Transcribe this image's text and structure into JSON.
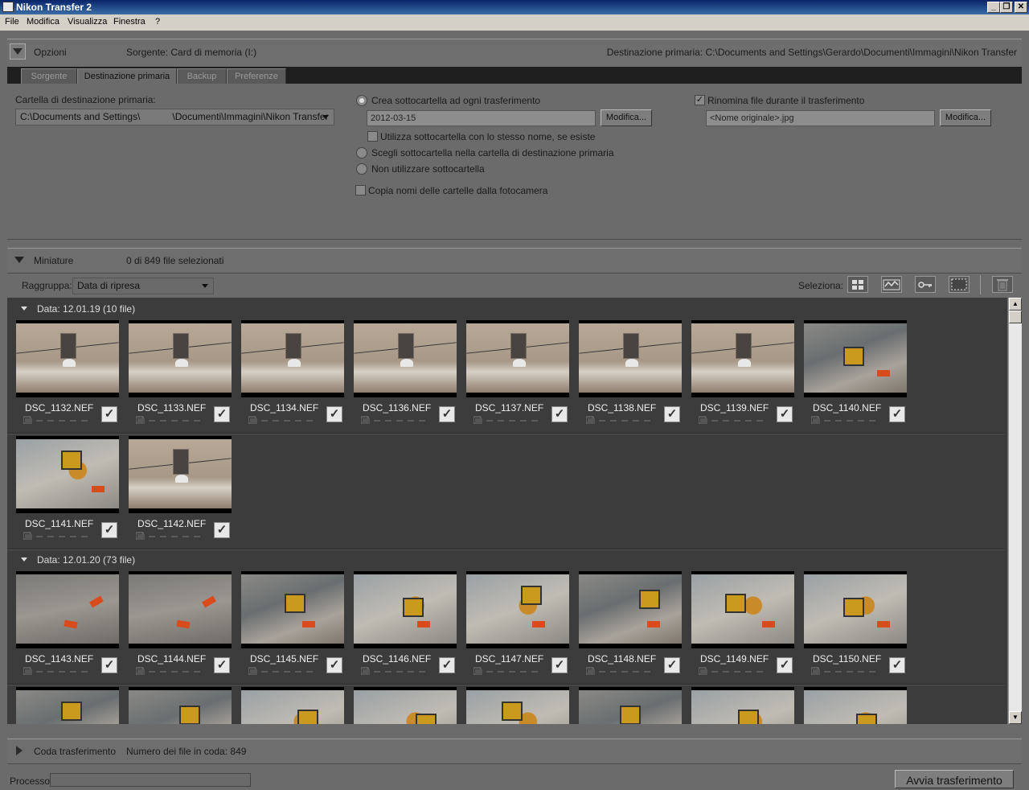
{
  "window": {
    "title": "Nikon Transfer 2"
  },
  "menu": [
    "File",
    "Modifica",
    "Visualizza",
    "Finestra",
    "?"
  ],
  "options_panel": {
    "label": "Opzioni",
    "source": "Sorgente: Card di memoria (I:)",
    "primary_destination": "Destinazione primaria: C:\\Documents and Settings\\Gerardo\\Documenti\\Immagini\\Nikon Transfer",
    "tabs": [
      "Sorgente",
      "Destinazione primaria",
      "Backup",
      "Preferenze"
    ],
    "active_tab": "Destinazione primaria",
    "dest_folder_label": "Cartella di destinazione primaria:",
    "dest_folder_value": "C:\\Documents and Settings\\            \\Documenti\\Immagini\\Nikon Transfer",
    "create_subfolder_label": "Crea sottocartella ad ogni trasferimento",
    "subfolder_name": "2012-03-15",
    "modify_label": "Modifica...",
    "use_existing_label": "Utilizza sottocartella con lo stesso nome, se esiste",
    "choose_subfolder_label": "Scegli sottocartella nella cartella di destinazione primaria",
    "no_subfolder_label": "Non utilizzare sottocartella",
    "copy_camera_folders_label": "Copia nomi delle cartelle dalla fotocamera",
    "rename_label": "Rinomina file durante il trasferimento",
    "rename_pattern": "<Nome originale>.jpg",
    "rename_modify_label": "Modifica..."
  },
  "thumbnails_panel": {
    "label": "Miniature",
    "selected_count": "0 di 849 file selezionati",
    "group_by_label": "Raggruppa:",
    "group_by_value": "Data di ripresa",
    "select_label": "Seleziona:",
    "select_icons": [
      "grid-icon",
      "wave-icon",
      "key-icon",
      "marquee-icon",
      "trash-icon"
    ],
    "groups": [
      {
        "title": "Data: 12.01.19 (10 file)",
        "files": [
          {
            "name": "DSC_1132.NEF",
            "kind": "facade"
          },
          {
            "name": "DSC_1133.NEF",
            "kind": "facade"
          },
          {
            "name": "DSC_1134.NEF",
            "kind": "facade"
          },
          {
            "name": "DSC_1136.NEF",
            "kind": "facade"
          },
          {
            "name": "DSC_1137.NEF",
            "kind": "facade"
          },
          {
            "name": "DSC_1138.NEF",
            "kind": "facade"
          },
          {
            "name": "DSC_1139.NEF",
            "kind": "facade"
          },
          {
            "name": "DSC_1140.NEF",
            "kind": "street"
          },
          {
            "name": "DSC_1141.NEF",
            "kind": "blur"
          },
          {
            "name": "DSC_1142.NEF",
            "kind": "facade"
          }
        ]
      },
      {
        "title": "Data: 12.01.20 (73 file)",
        "files": [
          {
            "name": "DSC_1143.NEF",
            "kind": "roof"
          },
          {
            "name": "DSC_1144.NEF",
            "kind": "roof"
          },
          {
            "name": "DSC_1145.NEF",
            "kind": "street"
          },
          {
            "name": "DSC_1146.NEF",
            "kind": "blur"
          },
          {
            "name": "DSC_1147.NEF",
            "kind": "blur"
          },
          {
            "name": "DSC_1148.NEF",
            "kind": "street"
          },
          {
            "name": "DSC_1149.NEF",
            "kind": "blur"
          },
          {
            "name": "DSC_1150.NEF",
            "kind": "blur"
          },
          {
            "name": "",
            "kind": "street"
          },
          {
            "name": "",
            "kind": "street"
          },
          {
            "name": "",
            "kind": "blur"
          },
          {
            "name": "",
            "kind": "blur"
          },
          {
            "name": "",
            "kind": "blur"
          },
          {
            "name": "",
            "kind": "street"
          },
          {
            "name": "",
            "kind": "blur"
          },
          {
            "name": "",
            "kind": "blur"
          }
        ]
      }
    ]
  },
  "queue_panel": {
    "label": "Coda trasferimento",
    "count": "Numero dei file in coda: 849"
  },
  "footer": {
    "process_label": "Processo:",
    "start_button": "Avvia trasferimento"
  }
}
